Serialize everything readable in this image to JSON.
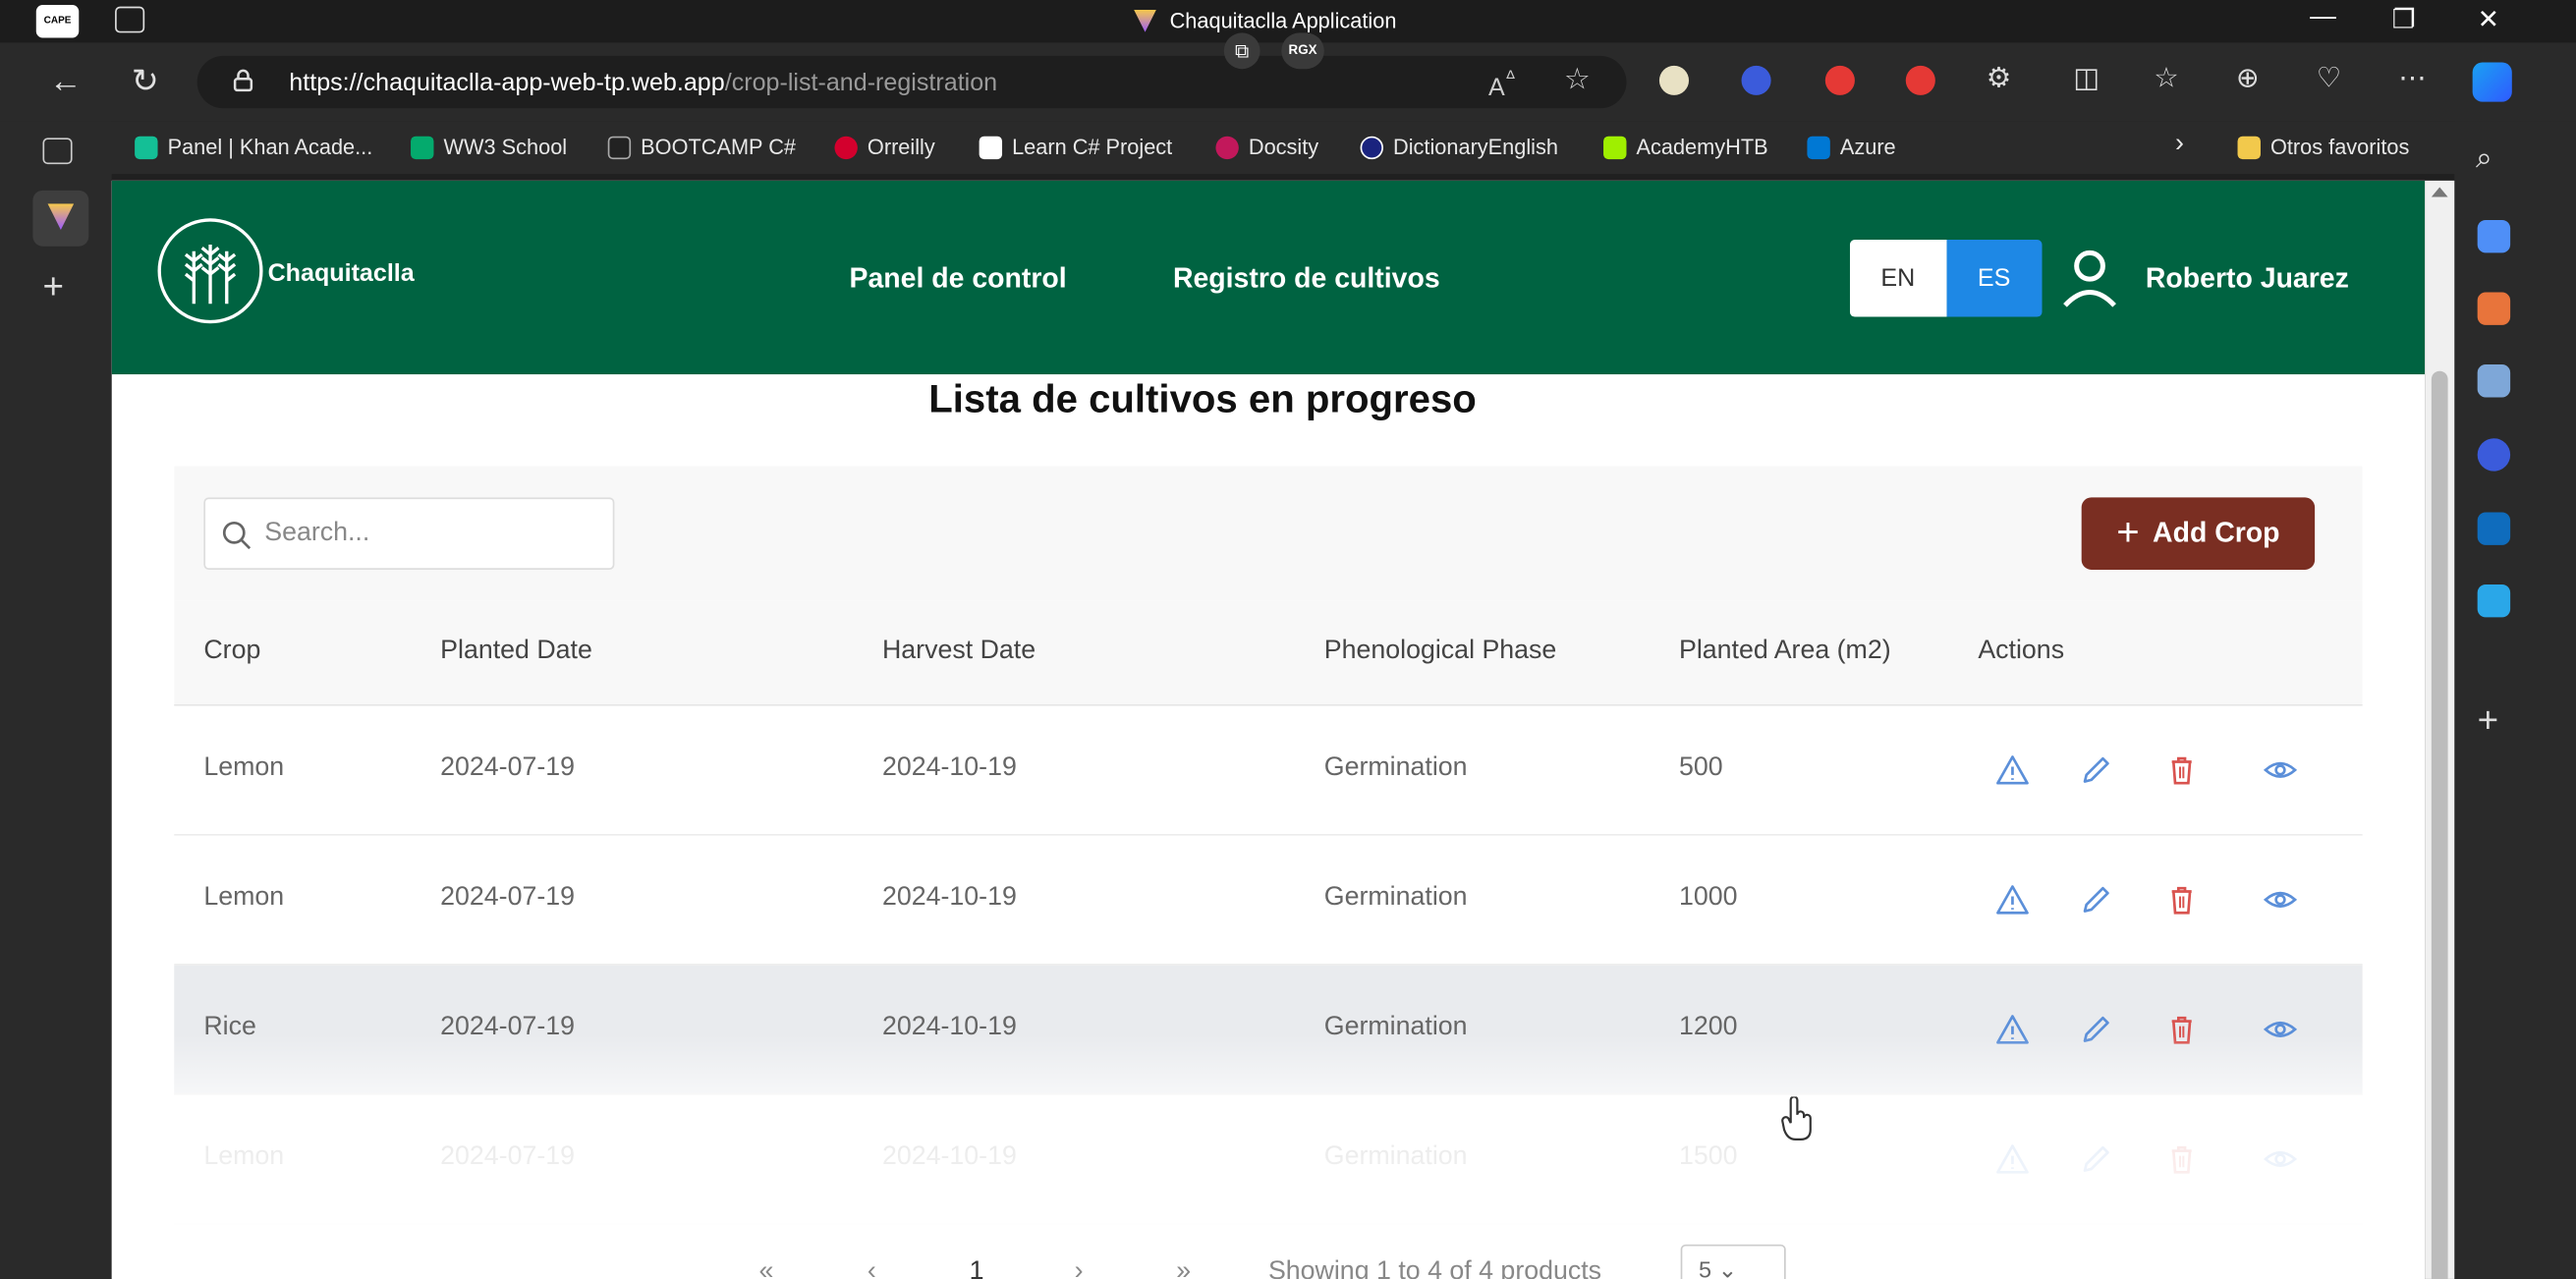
{
  "window": {
    "title": "Chaquitaclla Application",
    "app_icon_label": "CAPE PLAY",
    "rgx_label": "RGX"
  },
  "browser": {
    "url_host": "https://chaquitaclla-app-web-tp.web.app",
    "url_path": "/crop-list-and-registration",
    "reader_label": "A",
    "bookmarks": [
      {
        "label": "Panel | Khan Acade...",
        "color": "#14bf96"
      },
      {
        "label": "WW3 School",
        "color": "#04aa6d"
      },
      {
        "label": "BOOTCAMP C#",
        "color": "#222222"
      },
      {
        "label": "Orreilly",
        "color": "#d3002d"
      },
      {
        "label": "Learn C# Project",
        "color": "#ffffff"
      },
      {
        "label": "Docsity",
        "color": "#c2185b"
      },
      {
        "label": "DictionaryEnglish",
        "color": "#1a237e"
      },
      {
        "label": "AcademyHTB",
        "color": "#9fef00"
      },
      {
        "label": "Azure",
        "color": "#0078d4"
      }
    ],
    "other_favorites": "Otros favoritos"
  },
  "app": {
    "brand": "Chaquitaclla",
    "nav": {
      "dashboard": "Panel de control",
      "crop_registry": "Registro de cultivos"
    },
    "language": {
      "en": "EN",
      "es": "ES",
      "selected": "ES"
    },
    "user_name": "Roberto Juarez",
    "colors": {
      "header": "#006341",
      "add_button": "#7a2e22",
      "active_lang": "#1e88e5"
    }
  },
  "main": {
    "title": "Lista de cultivos en progreso",
    "search_placeholder": "Search...",
    "add_button_label": "Add Crop",
    "table": {
      "columns": [
        "Crop",
        "Planted Date",
        "Harvest Date",
        "Phenological Phase",
        "Planted Area (m2)",
        "Actions"
      ],
      "rows": [
        {
          "crop": "Lemon",
          "planted": "2024-07-19",
          "harvest": "2024-10-19",
          "phase": "Germination",
          "area": "500"
        },
        {
          "crop": "Lemon",
          "planted": "2024-07-19",
          "harvest": "2024-10-19",
          "phase": "Germination",
          "area": "1000"
        },
        {
          "crop": "Rice",
          "planted": "2024-07-19",
          "harvest": "2024-10-19",
          "phase": "Germination",
          "area": "1200"
        },
        {
          "crop": "Lemon",
          "planted": "2024-07-19",
          "harvest": "2024-10-19",
          "phase": "Germination",
          "area": "1500"
        }
      ],
      "action_icons": [
        "warning-icon",
        "edit-pencil-icon",
        "delete-trash-icon",
        "view-eye-icon"
      ]
    },
    "pagination": {
      "first": "«",
      "prev": "‹",
      "page": "1",
      "next": "›",
      "last": "»",
      "summary": "Showing 1 to 4 of 4 products",
      "per_page": "5"
    }
  }
}
